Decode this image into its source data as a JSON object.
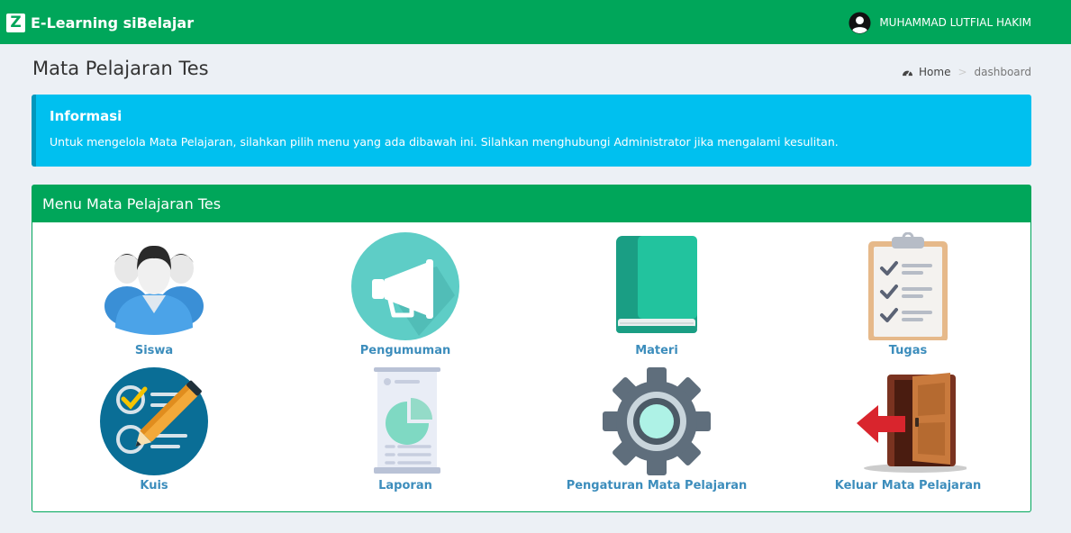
{
  "header": {
    "app_title": "E-Learning siBelajar",
    "logo_letter": "Z",
    "user_name": "MUHAMMAD LUTFIAL HAKIM"
  },
  "page": {
    "title": "Mata Pelajaran Tes",
    "breadcrumb": {
      "home": "Home",
      "current": "dashboard"
    }
  },
  "info": {
    "title": "Informasi",
    "text": "Untuk mengelola Mata Pelajaran, silahkan pilih menu yang ada dibawah ini. Silahkan menghubungi Administrator jika mengalami kesulitan."
  },
  "menu": {
    "title": "Menu Mata Pelajaran Tes",
    "items": [
      {
        "label": "Siswa",
        "icon": "students-icon"
      },
      {
        "label": "Pengumuman",
        "icon": "megaphone-icon"
      },
      {
        "label": "Materi",
        "icon": "book-icon"
      },
      {
        "label": "Tugas",
        "icon": "clipboard-checklist-icon"
      },
      {
        "label": "Kuis",
        "icon": "quiz-pencil-icon"
      },
      {
        "label": "Laporan",
        "icon": "report-icon"
      },
      {
        "label": "Pengaturan Mata Pelajaran",
        "icon": "gear-icon"
      },
      {
        "label": "Keluar Mata Pelajaran",
        "icon": "exit-door-icon"
      }
    ]
  },
  "colors": {
    "primary": "#00a65a",
    "info": "#00c0ef",
    "link": "#3c8dbc",
    "background": "#ecf0f5"
  }
}
